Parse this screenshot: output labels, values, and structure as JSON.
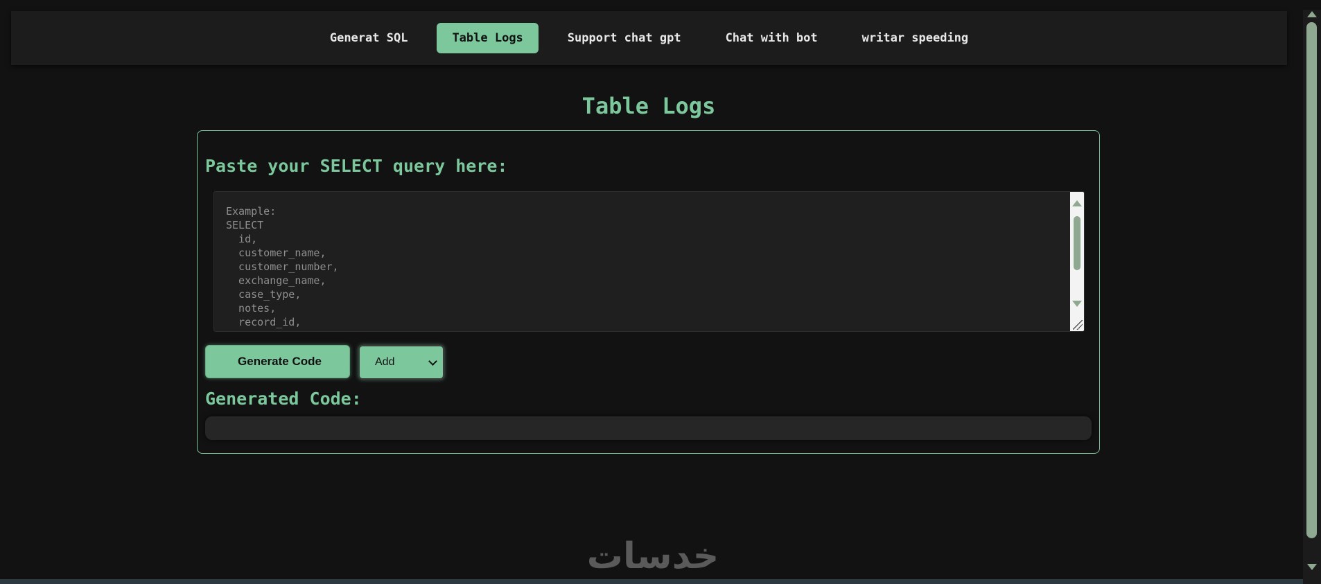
{
  "nav": {
    "items": [
      {
        "label": "Generat SQL",
        "active": false
      },
      {
        "label": "Table Logs",
        "active": true
      },
      {
        "label": "Support chat gpt",
        "active": false
      },
      {
        "label": "Chat with bot",
        "active": false
      },
      {
        "label": "writar speeding",
        "active": false
      }
    ]
  },
  "page": {
    "title": "Table Logs"
  },
  "query_section": {
    "label": "Paste your SELECT query here:",
    "placeholder": "Example:\nSELECT\n  id,\n  customer_name,\n  customer_number,\n  exchange_name,\n  case_type,\n  notes,\n  record_id,\n  ..."
  },
  "actions": {
    "generate_icon": "",
    "generate_label": "Generate Code",
    "select_value": "Add"
  },
  "generated_section": {
    "label": "Generated Code:",
    "output": ""
  },
  "footer": {
    "logo_text": "خدسات"
  },
  "colors": {
    "accent": "#7cc79c",
    "background": "#121212",
    "navbar": "#1c1c1c"
  }
}
